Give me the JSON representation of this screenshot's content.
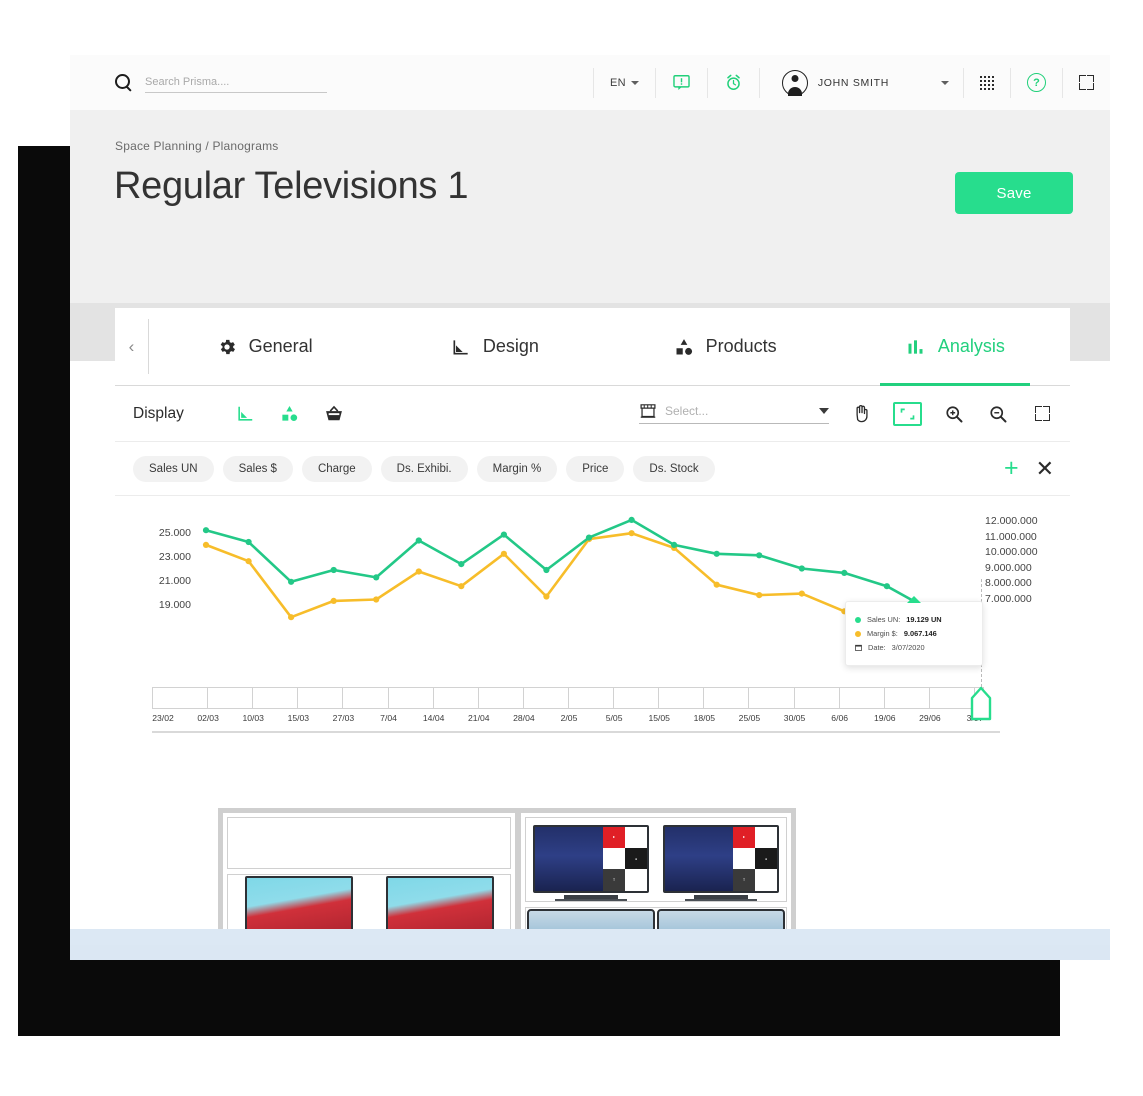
{
  "header": {
    "search": {
      "placeholder": "Search Prisma....",
      "value": "",
      "icon": "search-icon"
    },
    "language": {
      "label": "EN",
      "icon": "chevron-down-icon"
    },
    "message_icon": "message-icon",
    "alarm_icon": "alarm-bell-icon",
    "user": {
      "name": "JOHN SMITH",
      "avatar_icon": "user-avatar-icon",
      "chevron_icon": "chevron-down-icon"
    },
    "apps_icon": "apps-grid-icon",
    "help_icon": "help-circle-icon",
    "fullscreen_icon": "fullscreen-icon"
  },
  "page": {
    "breadcrumb": "Space Planning / Planograms",
    "title": "Regular Televisions 1",
    "save_label": "Save"
  },
  "tabs": {
    "back_icon": "chevron-left-icon",
    "items": [
      {
        "label": "General",
        "icon": "gear-icon",
        "active": false
      },
      {
        "label": "Design",
        "icon": "ruler-icon",
        "active": false
      },
      {
        "label": "Products",
        "icon": "shapes-icon",
        "active": false
      },
      {
        "label": "Analysis",
        "icon": "bar-chart-icon",
        "active": true
      }
    ]
  },
  "display_toolbar": {
    "label": "Display",
    "icons": [
      {
        "name": "ruler-icon",
        "color": "#27dd8d"
      },
      {
        "name": "shapes-icon",
        "color": "#27dd8d"
      },
      {
        "name": "basket-icon",
        "color": "#2b2b2b"
      }
    ],
    "store_select": {
      "icon": "store-icon",
      "placeholder": "Select...",
      "value": "",
      "caret_icon": "caret-down-icon"
    },
    "tools": [
      {
        "name": "hand-tool-icon",
        "active": false
      },
      {
        "name": "fit-to-screen-icon",
        "active": true
      },
      {
        "name": "zoom-in-icon",
        "active": false
      },
      {
        "name": "zoom-out-icon",
        "active": false
      },
      {
        "name": "fullscreen-icon",
        "active": false
      }
    ]
  },
  "metric_chips": {
    "items": [
      "Sales UN",
      "Sales $",
      "Charge",
      "Ds. Exhibi.",
      "Margin %",
      "Price",
      "Ds. Stock"
    ],
    "add_icon": "plus-icon",
    "close_icon": "close-icon"
  },
  "tooltip": {
    "rows": [
      {
        "icon": "green-dot",
        "label": "Sales UN:",
        "value": "19.129 UN",
        "color": "#27dd8d"
      },
      {
        "icon": "yellow-dot",
        "label": "Margin $:",
        "value": "9.067.146",
        "color": "#f7bd2a"
      },
      {
        "icon": "calendar-icon",
        "label": "Date:",
        "value": "3/07/2020",
        "color": "#3a3a3a"
      }
    ]
  },
  "colors": {
    "accent_green": "#27dd8d",
    "series_green": "#23c887",
    "series_yellow": "#f7bd2a",
    "title_text": "#333333"
  },
  "chart_data": {
    "type": "line",
    "title": "",
    "xlabel": "",
    "ylabel": "",
    "grid": false,
    "legend": "tooltip",
    "categories": [
      "23/02",
      "02/03",
      "10/03",
      "15/03",
      "27/03",
      "7/04",
      "14/04",
      "21/04",
      "28/04",
      "2/05",
      "5/05",
      "15/05",
      "18/05",
      "25/05",
      "30/05",
      "6/06",
      "19/06",
      "29/06",
      "3/07"
    ],
    "y_axis_left": {
      "ticks": [
        "25.000",
        "23.000",
        "21.000",
        "19.000"
      ],
      "min": 18000,
      "max": 26000
    },
    "y_axis_right": {
      "ticks": [
        "12.000.000",
        "11.000.000",
        "10.000.000",
        "9.000.000",
        "8.000.000",
        "7.000.000"
      ],
      "min": 6500000,
      "max": 12500000
    },
    "series": [
      {
        "name": "Sales UN",
        "axis": "left",
        "color": "#23c887",
        "values": [
          25100,
          24300,
          21600,
          22400,
          21900,
          24400,
          22800,
          24800,
          22400,
          24600,
          25800,
          24100,
          23500,
          23400,
          22500,
          22200,
          21300,
          19700,
          19129
        ]
      },
      {
        "name": "Margin $",
        "axis": "right",
        "color": "#f7bd2a",
        "values": [
          24100,
          23000,
          19200,
          20300,
          20400,
          22300,
          21300,
          23500,
          20600,
          24500,
          24900,
          23900,
          21400,
          20700,
          20800,
          19600,
          18900,
          18600,
          9067146
        ]
      }
    ],
    "highlight": {
      "category": "3/07",
      "sales_un": "19.129 UN",
      "margin": "9.067.146",
      "date": "3/07/2020"
    }
  },
  "planogram": {
    "name": "planogram-preview",
    "bays": [
      {
        "name": "left-bay",
        "shelves": [
          {
            "name": "empty-shelf",
            "products": []
          },
          {
            "name": "tv-shelf-red",
            "products": [
              "tv-red-landscape",
              "tv-red-landscape"
            ]
          },
          {
            "name": "tv-shelf-linetv",
            "products": [
              "tv-line-tv",
              "tv-line-tv"
            ]
          }
        ]
      },
      {
        "name": "right-bay",
        "shelves": [
          {
            "name": "tv-shelf-smart",
            "products": [
              "tv-smart-hub",
              "tv-smart-hub"
            ]
          },
          {
            "name": "tv-shelf-curved",
            "products": [
              "tv-curved-blue",
              "tv-curved-blue"
            ]
          }
        ]
      }
    ]
  }
}
